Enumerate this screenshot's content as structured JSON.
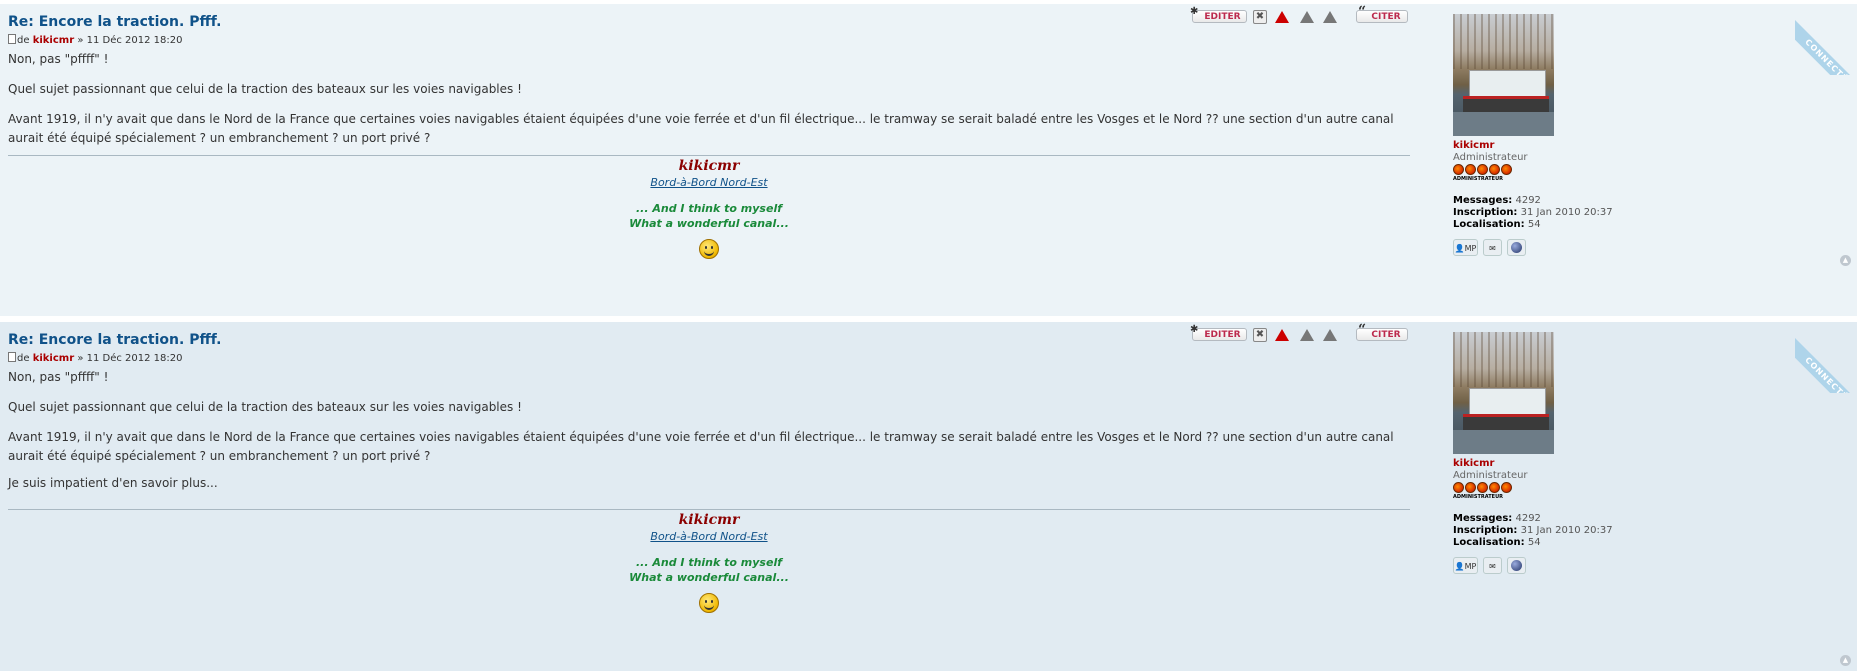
{
  "posts": [
    {
      "title": "Re: Encore la traction. Pfff.",
      "author_prefix": "de",
      "author": "kikicmr",
      "date": "» 11 Déc 2012 18:20",
      "buttons": {
        "edit": "EDITER",
        "quote": "CITER"
      },
      "paragraphs": [
        "Non, pas \"pffff\" !",
        "Quel sujet passionnant que celui de la traction des bateaux sur les voies navigables !",
        "Avant 1919, il n'y avait que dans le Nord de la France que certaines voies navigables étaient équipées d'une voie ferrée et d'un fil électrique... le tramway se serait baladé entre les Vosges et le Nord ?? une section d'un autre canal aurait été équipé spécialement ? un embranchement ? un port privé ?"
      ],
      "signature": {
        "name": "kikicmr",
        "link": "Bord-à-Bord Nord-Est",
        "quote_line1": "... And I think to myself",
        "quote_line2": "What a wonderful canal..."
      },
      "profile": {
        "username": "kikicmr",
        "rank": "Administrateur",
        "rank_image_text": "ADMINISTRATEUR",
        "messages_label": "Messages:",
        "messages": "4292",
        "inscription_label": "Inscription:",
        "inscription": "31 Jan 2010 20:37",
        "localisation_label": "Localisation:",
        "localisation": "54",
        "pm_label": "MP",
        "online_label": "CONNECTÉ"
      }
    },
    {
      "title": "Re: Encore la traction. Pfff.",
      "author_prefix": "de",
      "author": "kikicmr",
      "date": "» 11 Déc 2012 18:20",
      "buttons": {
        "edit": "EDITER",
        "quote": "CITER"
      },
      "paragraphs": [
        "Non, pas \"pffff\" !",
        "Quel sujet passionnant que celui de la traction des bateaux sur les voies navigables !",
        "Avant 1919, il n'y avait que dans le Nord de la France que certaines voies navigables étaient équipées d'une voie ferrée et d'un fil électrique... le tramway se serait baladé entre les Vosges et le Nord ?? une section d'un autre canal aurait été équipé spécialement ? un embranchement ? un port privé ?",
        "Je suis impatient d'en savoir plus..."
      ],
      "signature": {
        "name": "kikicmr",
        "link": "Bord-à-Bord Nord-Est",
        "quote_line1": "... And I think to myself",
        "quote_line2": "What a wonderful canal..."
      },
      "profile": {
        "username": "kikicmr",
        "rank": "Administrateur",
        "rank_image_text": "ADMINISTRATEUR",
        "messages_label": "Messages:",
        "messages": "4292",
        "inscription_label": "Inscription:",
        "inscription": "31 Jan 2010 20:37",
        "localisation_label": "Localisation:",
        "localisation": "54",
        "pm_label": "MP",
        "online_label": "CONNECTÉ"
      }
    }
  ],
  "colors": {
    "post1_bg": "#ecf3f7",
    "post2_bg": "#e1ebf2",
    "title": "#105289",
    "username": "#aa0000",
    "signature_quote": "#1a8a3a",
    "button_text": "#bc2a4d",
    "online_ribbon": "#aed4ea"
  }
}
